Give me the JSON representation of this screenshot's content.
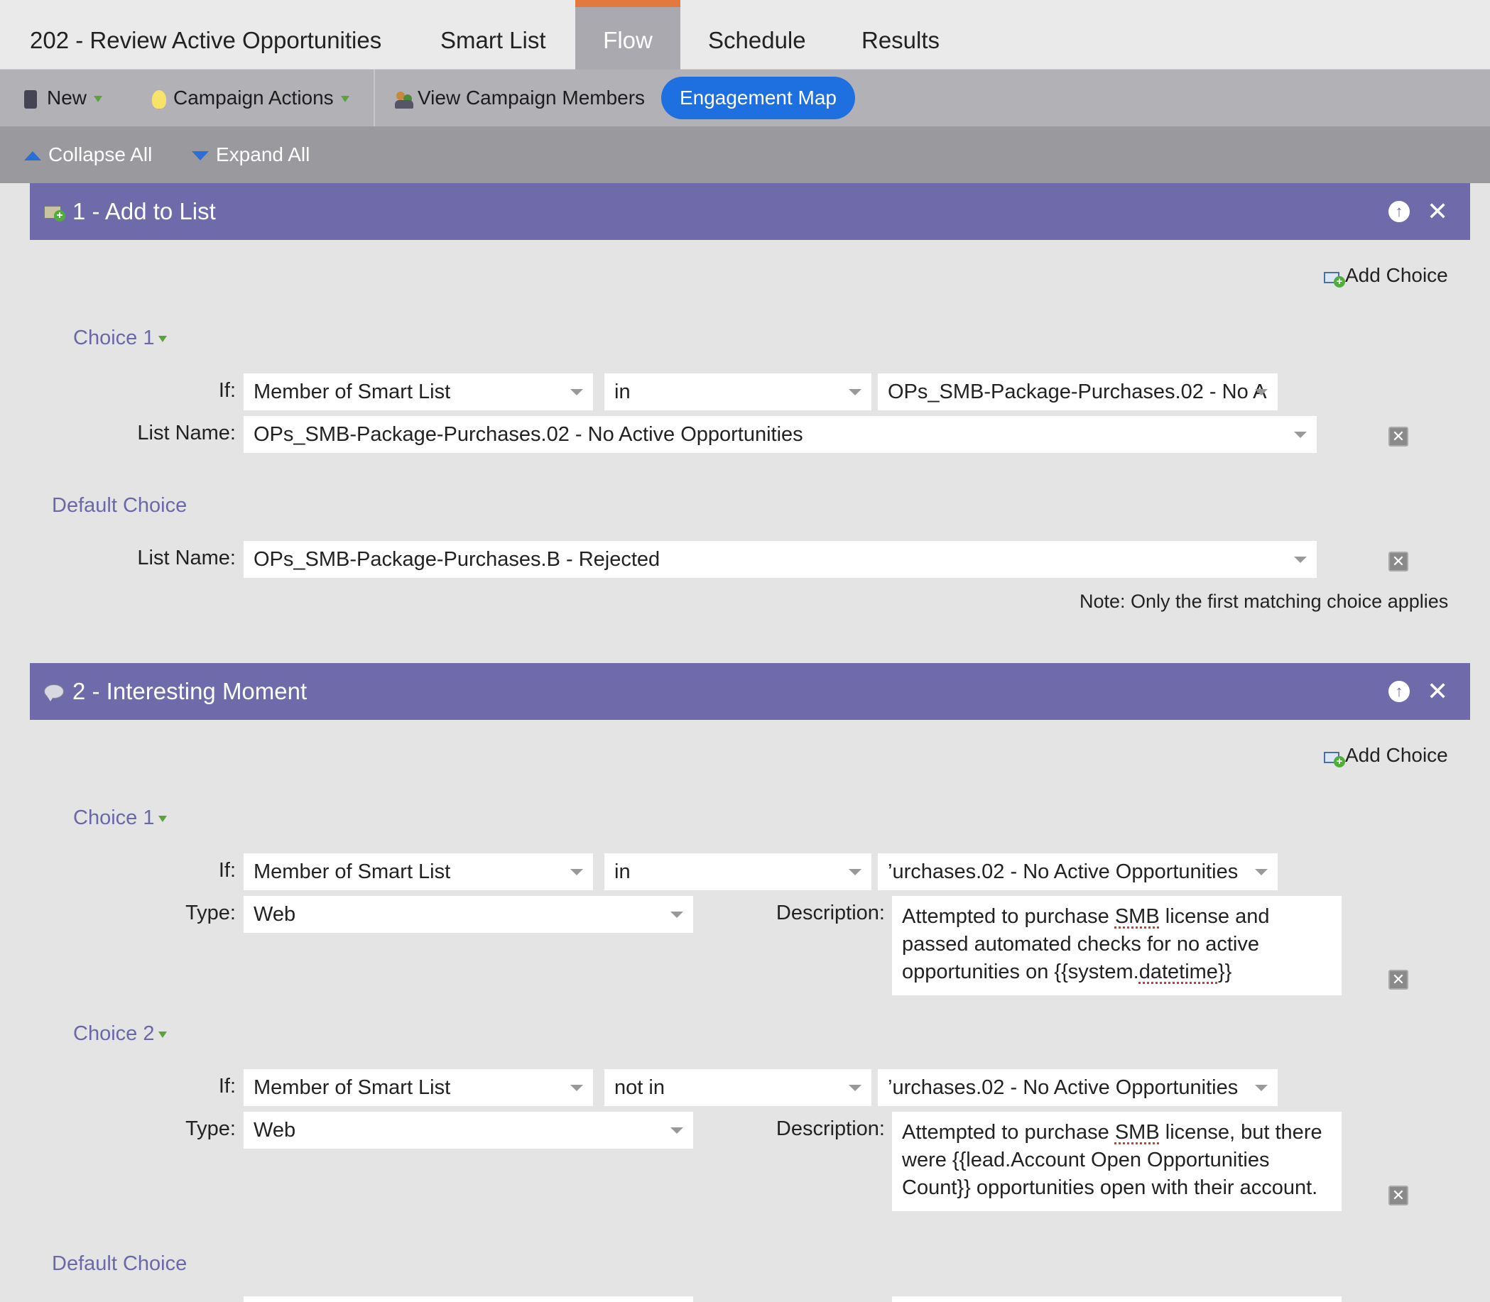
{
  "tabs": {
    "campaign_title": "202 - Review Active Opportunities",
    "smart_list": "Smart List",
    "flow": "Flow",
    "schedule": "Schedule",
    "results": "Results"
  },
  "toolbar": {
    "new": "New",
    "campaign_actions": "Campaign Actions",
    "view_members": "View Campaign Members",
    "engagement_map": "Engagement Map"
  },
  "expand": {
    "collapse_all": "Collapse All",
    "expand_all": "Expand All"
  },
  "step1": {
    "title": "1 - Add to List",
    "add_choice": "Add Choice",
    "choice1": {
      "heading": "Choice 1",
      "if_label": "If:",
      "condition": "Member of Smart List",
      "operator": "in",
      "value": "OPs_SMB-Package-Purchases.02 - No A",
      "list_label": "List Name:",
      "list_value": "OPs_SMB-Package-Purchases.02 - No Active Opportunities"
    },
    "default": {
      "heading": "Default Choice",
      "list_label": "List Name:",
      "list_value": "OPs_SMB-Package-Purchases.B - Rejected"
    },
    "note": "Note: Only the first matching choice applies"
  },
  "step2": {
    "title": "2 - Interesting Moment",
    "add_choice": "Add Choice",
    "choice1": {
      "heading": "Choice 1",
      "if_label": "If:",
      "condition": "Member of Smart List",
      "operator": "in",
      "value": "’urchases.02 - No Active Opportunities",
      "type_label": "Type:",
      "type_value": "Web",
      "desc_label": "Description:",
      "desc_p1": "Attempted to purchase ",
      "desc_smb": "SMB",
      "desc_p2": " license and passed automated checks for no active opportunities on {{system.",
      "desc_dt": "datetime",
      "desc_p3": "}}"
    },
    "choice2": {
      "heading": "Choice 2",
      "if_label": "If:",
      "condition": "Member of Smart List",
      "operator": "not in",
      "value": "’urchases.02 - No Active Opportunities",
      "type_label": "Type:",
      "type_value": "Web",
      "desc_label": "Description:",
      "desc_p1": "Attempted to purchase ",
      "desc_smb": "SMB",
      "desc_p2": " license, but there were {{lead.Account Open Opportunities Count}} opportunities open with their account."
    },
    "default": {
      "heading": "Default Choice"
    }
  },
  "colors": {
    "panel_header": "#6f6bab",
    "active_tab_accent": "#e27a3f",
    "engagement_button": "#1e6fe0"
  }
}
